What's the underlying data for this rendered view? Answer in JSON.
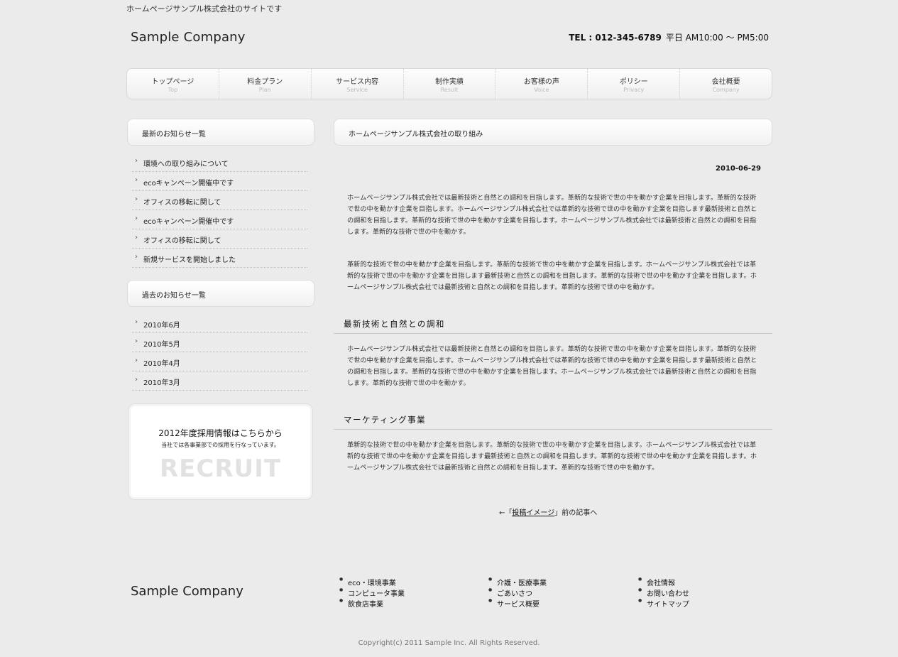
{
  "header": {
    "tagline": "ホームページサンプル株式会社のサイトです",
    "logo": "Sample Company",
    "tel": "TEL : 012-345-6789",
    "hours": "平日 AM10:00 〜 PM5:00"
  },
  "nav": [
    {
      "jp": "トップページ",
      "en": "Top"
    },
    {
      "jp": "料金プラン",
      "en": "Plan"
    },
    {
      "jp": "サービス内容",
      "en": "Service"
    },
    {
      "jp": "制作実績",
      "en": "Result"
    },
    {
      "jp": "お客様の声",
      "en": "Voice"
    },
    {
      "jp": "ポリシー",
      "en": "Privacy"
    },
    {
      "jp": "会社概要",
      "en": "Company"
    }
  ],
  "sidebar": {
    "latest_title": "最新のお知らせ一覧",
    "latest_items": [
      "環境への取り組みについて",
      "ecoキャンペーン開催中です",
      "オフィスの移転に関して",
      "ecoキャンペーン開催中です",
      "オフィスの移転に関して",
      "新規サービスを開始しました"
    ],
    "past_title": "過去のお知らせ一覧",
    "past_items": [
      "2010年6月",
      "2010年5月",
      "2010年4月",
      "2010年3月"
    ],
    "recruit": {
      "title": "2012年度採用情報はこちらから",
      "subtitle": "当社では各事業部での採用を行なっています。",
      "big": "RECRUIT"
    }
  },
  "main": {
    "title": "ホームページサンプル株式会社の取り組み",
    "date": "2010-06-29",
    "para1": "ホームページサンプル株式会社では最新技術と自然との調和を目指します。革新的な技術で世の中を動かす企業を目指します。革新的な技術で世の中を動かす企業を目指します。ホームページサンプル株式会社では革新的な技術で世の中を動かす企業を目指します最新技術と自然との調和を目指します。革新的な技術で世の中を動かす企業を目指します。ホームページサンプル株式会社では最新技術と自然との調和を目指します。革新的な技術で世の中を動かす。",
    "para2": "革新的な技術で世の中を動かす企業を目指します。革新的な技術で世の中を動かす企業を目指します。ホームページサンプル株式会社では革新的な技術で世の中を動かす企業を目指します最新技術と自然との調和を目指します。革新的な技術で世の中を動かす企業を目指します。ホームページサンプル株式会社では最新技術と自然との調和を目指します。革新的な技術で世の中を動かす。",
    "heading1": "最新技術と自然との調和",
    "para3": "ホームページサンプル株式会社では最新技術と自然との調和を目指します。革新的な技術で世の中を動かす企業を目指します。革新的な技術で世の中を動かす企業を目指します。ホームページサンプル株式会社では革新的な技術で世の中を動かす企業を目指します最新技術と自然との調和を目指します。革新的な技術で世の中を動かす企業を目指します。ホームページサンプル株式会社では最新技術と自然との調和を目指します。革新的な技術で世の中を動かす。",
    "heading2": "マーケティング事業",
    "para4": "革新的な技術で世の中を動かす企業を目指します。革新的な技術で世の中を動かす企業を目指します。ホームページサンプル株式会社では革新的な技術で世の中を動かす企業を目指します最新技術と自然との調和を目指します。革新的な技術で世の中を動かす企業を目指します。ホームページサンプル株式会社では最新技術と自然との調和を目指します。革新的な技術で世の中を動かす。",
    "prev_prefix": "←「",
    "prev_link": "投稿イメージ",
    "prev_suffix": "」前の記事へ"
  },
  "footer": {
    "logo": "Sample Company",
    "col1": [
      "eco・環境事業",
      "コンピュータ事業",
      "飲食店事業"
    ],
    "col2": [
      "介護・医療事業",
      "ごあいさつ",
      "サービス概要"
    ],
    "col3": [
      "会社情報",
      "お問い合わせ",
      "サイトマップ"
    ],
    "copyright": "Copyright(c) 2011 Sample Inc. All Rights Reserved."
  }
}
